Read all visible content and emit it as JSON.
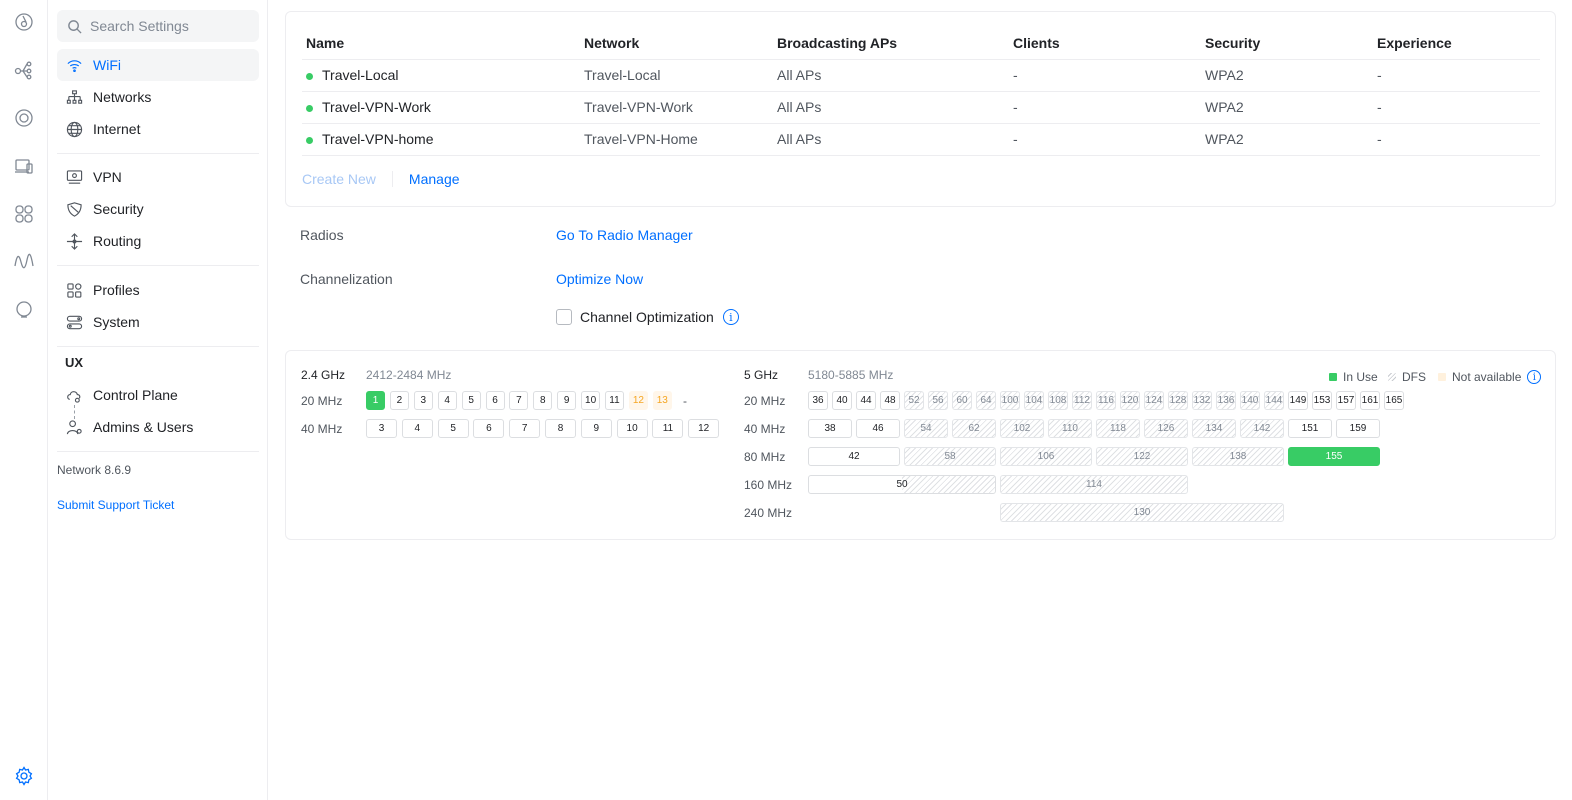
{
  "rail": {
    "icons": [
      "dashboard-icon",
      "topology-icon",
      "devices-icon",
      "clients-icon",
      "statistics-icon",
      "wave-icon",
      "insights-icon",
      "settings-icon"
    ]
  },
  "sidebar": {
    "search_placeholder": "Search Settings",
    "items": [
      {
        "label": "WiFi",
        "icon": "wifi-icon",
        "active": true
      },
      {
        "label": "Networks",
        "icon": "networks-icon"
      },
      {
        "label": "Internet",
        "icon": "globe-icon"
      },
      {
        "label": "VPN",
        "icon": "vpn-icon"
      },
      {
        "label": "Security",
        "icon": "shield-icon"
      },
      {
        "label": "Routing",
        "icon": "routing-icon"
      },
      {
        "label": "Profiles",
        "icon": "profiles-icon"
      },
      {
        "label": "System",
        "icon": "system-icon"
      }
    ],
    "ux_section": "UX",
    "ux_items": [
      {
        "label": "Control Plane",
        "icon": "cloud-gear-icon"
      },
      {
        "label": "Admins & Users",
        "icon": "user-gear-icon"
      }
    ],
    "version": "Network 8.6.9",
    "support": "Submit Support Ticket"
  },
  "wifi_table": {
    "headers": [
      "Name",
      "Network",
      "Broadcasting APs",
      "Clients",
      "Security",
      "Experience"
    ],
    "rows": [
      {
        "name": "Travel-Local",
        "network": "Travel-Local",
        "aps": "All APs",
        "clients": "-",
        "security": "WPA2",
        "experience": "-"
      },
      {
        "name": "Travel-VPN-Work",
        "network": "Travel-VPN-Work",
        "aps": "All APs",
        "clients": "-",
        "security": "WPA2",
        "experience": "-"
      },
      {
        "name": "Travel-VPN-home",
        "network": "Travel-VPN-Home",
        "aps": "All APs",
        "clients": "-",
        "security": "WPA2",
        "experience": "-"
      }
    ],
    "create_new": "Create New",
    "manage": "Manage"
  },
  "radios": {
    "label": "Radios",
    "link": "Go To Radio Manager"
  },
  "channelization": {
    "label": "Channelization",
    "link": "Optimize Now",
    "checkbox_label": "Channel Optimization",
    "info": "i"
  },
  "band24": {
    "band": "2.4 GHz",
    "range": "2412-2484 MHz",
    "w20": "20 MHz",
    "w40": "40 MHz",
    "ch20": [
      "1",
      "2",
      "3",
      "4",
      "5",
      "6",
      "7",
      "8",
      "9",
      "10",
      "11",
      "12",
      "13"
    ],
    "ch20_state": [
      "inuse",
      "",
      "",
      "",
      "",
      "",
      "",
      "",
      "",
      "",
      "",
      "na",
      "na"
    ],
    "ch20_tail": "-",
    "ch40": [
      "3",
      "4",
      "5",
      "6",
      "7",
      "8",
      "9",
      "10",
      "11",
      "12"
    ]
  },
  "band5": {
    "band": "5 GHz",
    "range": "5180-5885 MHz",
    "w20": "20 MHz",
    "w40": "40 MHz",
    "w80": "80 MHz",
    "w160": "160 MHz",
    "w240": "240 MHz",
    "ch20": [
      "36",
      "40",
      "44",
      "48",
      "52",
      "56",
      "60",
      "64",
      "100",
      "104",
      "108",
      "112",
      "116",
      "120",
      "124",
      "128",
      "132",
      "136",
      "140",
      "144",
      "149",
      "153",
      "157",
      "161",
      "165"
    ],
    "ch40": [
      "38",
      "46",
      "54",
      "62",
      "102",
      "110",
      "118",
      "126",
      "134",
      "142",
      "151",
      "159"
    ],
    "ch80": [
      "42",
      "58",
      "106",
      "122",
      "138",
      "155"
    ],
    "ch160": [
      "50",
      "114"
    ],
    "ch240": [
      "130"
    ]
  },
  "legend": {
    "in_use": "In Use",
    "dfs": "DFS",
    "not_available": "Not available"
  },
  "colors": {
    "accent": "#006fff",
    "in_use": "#38cc65",
    "not_available": "#fff6ea"
  }
}
